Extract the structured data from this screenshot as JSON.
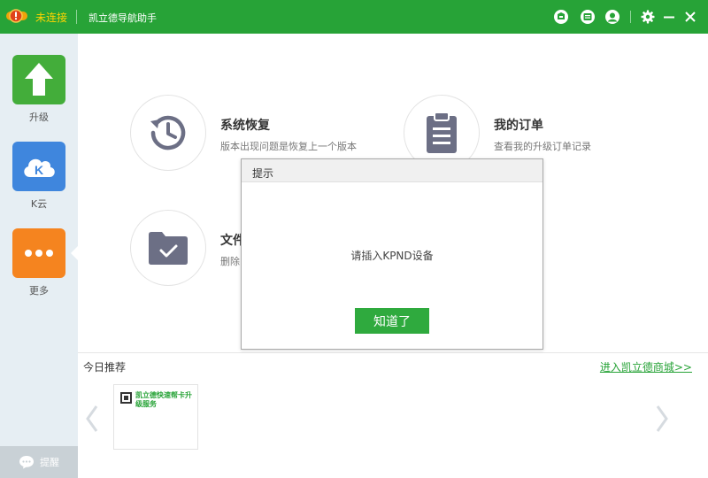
{
  "window": {
    "status": "未连接",
    "title": "凯立德导航助手"
  },
  "titlebar_icons": [
    "status-warning-icon",
    "skin-icon",
    "message-icon",
    "user-icon",
    "settings-icon",
    "minimize-icon",
    "close-icon"
  ],
  "sidebar": {
    "items": [
      {
        "label": "升级",
        "icon": "upgrade-arrow-icon",
        "color": "#43ad3a"
      },
      {
        "label": "K云",
        "icon": "k-cloud-icon",
        "color": "#3f86dd"
      },
      {
        "label": "更多",
        "icon": "more-dots-icon",
        "color": "#f5841f"
      }
    ],
    "active": "更多",
    "remind_label": "提醒"
  },
  "features": [
    {
      "title": "系统恢复",
      "desc": "版本出现问题是恢复上一个版本",
      "icon": "history-restore-icon"
    },
    {
      "title": "我的订单",
      "desc": "查看我的升级订单记录",
      "icon": "clipboard-icon"
    },
    {
      "title": "文件",
      "desc": "删除",
      "icon": "folder-check-icon"
    }
  ],
  "recommend": {
    "label": "今日推荐",
    "mall_link": "进入凯立德商城>>",
    "card_text": "凯立德快速帮卡升级服务"
  },
  "dialog": {
    "title": "提示",
    "message": "请插入KPND设备",
    "ok_label": "知道了"
  },
  "colors": {
    "titlebar": "#27a337",
    "status_text": "#ffd400",
    "accent_green": "#27a337",
    "sidebar_bg": "#e6eef3"
  }
}
